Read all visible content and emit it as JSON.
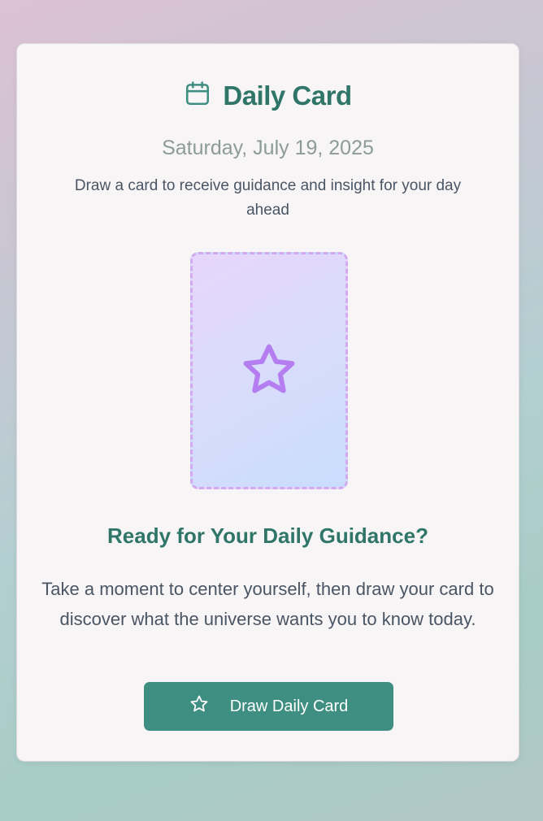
{
  "header": {
    "title": "Daily Card",
    "date": "Saturday, July 19, 2025",
    "subtitle": "Draw a card to receive guidance and insight for your day ahead",
    "icon": "calendar-icon"
  },
  "card": {
    "icon": "star-icon",
    "state": "face-down"
  },
  "prompt": {
    "heading": "Ready for Your Daily Guidance?",
    "description": "Take a moment to center yourself, then draw your card to discover what the universe wants you to know today."
  },
  "action": {
    "label": "Draw Daily Card",
    "icon": "star-icon"
  },
  "colors": {
    "accent": "#2f7568",
    "button": "#3f8e82",
    "card_border": "#d3aaf0",
    "star": "#b57ef0"
  }
}
